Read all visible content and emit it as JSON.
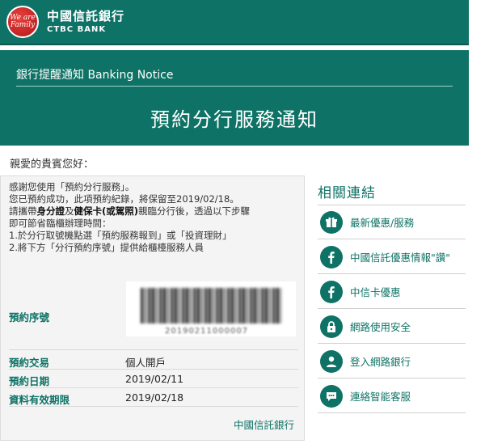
{
  "header": {
    "logo_script": "We are Family",
    "bank_name_cn": "中國信託銀行",
    "bank_name_en": "CTBC BANK"
  },
  "banner": {
    "subtitle": "銀行提醒通知 Banking Notice",
    "title": "預約分行服務通知"
  },
  "greeting": "親愛的貴賓您好：",
  "message": {
    "line1": "感謝您使用「預約分行服務」。",
    "line2": "您已預約成功，此項預約紀錄，將保留至2019/02/18。",
    "line3_pre": "請攜帶",
    "line3_bold1": "身分證",
    "line3_mid": "及",
    "line3_bold2": "健保卡(或駕照)",
    "line3_post": "親臨分行後，透過以下步驟",
    "line4": "即可節省臨櫃辦理時間：",
    "line5": "1.於分行取號機點選「預約服務報到」或「投資理財」",
    "line6": "2.將下方「分行預約序號」提供給櫃檯服務人員"
  },
  "reservation": {
    "serial_label": "預約序號",
    "serial_value": "20190211000007",
    "transaction_label": "預約交易",
    "transaction_value": "個人開戶",
    "date_label": "預約日期",
    "date_value": "2019/02/11",
    "expiry_label": "資料有效期限",
    "expiry_value": "2019/02/18"
  },
  "footer_bank": "中國信託銀行",
  "sidebar": {
    "title": "相關連結",
    "items": [
      {
        "label": "最新優惠/服務",
        "icon": "gift-icon"
      },
      {
        "label": "中國信託優惠情報\"讚\"",
        "icon": "facebook-icon"
      },
      {
        "label": "中信卡優惠",
        "icon": "facebook-icon"
      },
      {
        "label": "網路使用安全",
        "icon": "lock-icon"
      },
      {
        "label": "登入網路銀行",
        "icon": "user-icon"
      },
      {
        "label": "連絡智能客服",
        "icon": "chat-icon"
      }
    ]
  },
  "colors": {
    "brand": "#0e7366",
    "logo_red": "#c8201f"
  }
}
